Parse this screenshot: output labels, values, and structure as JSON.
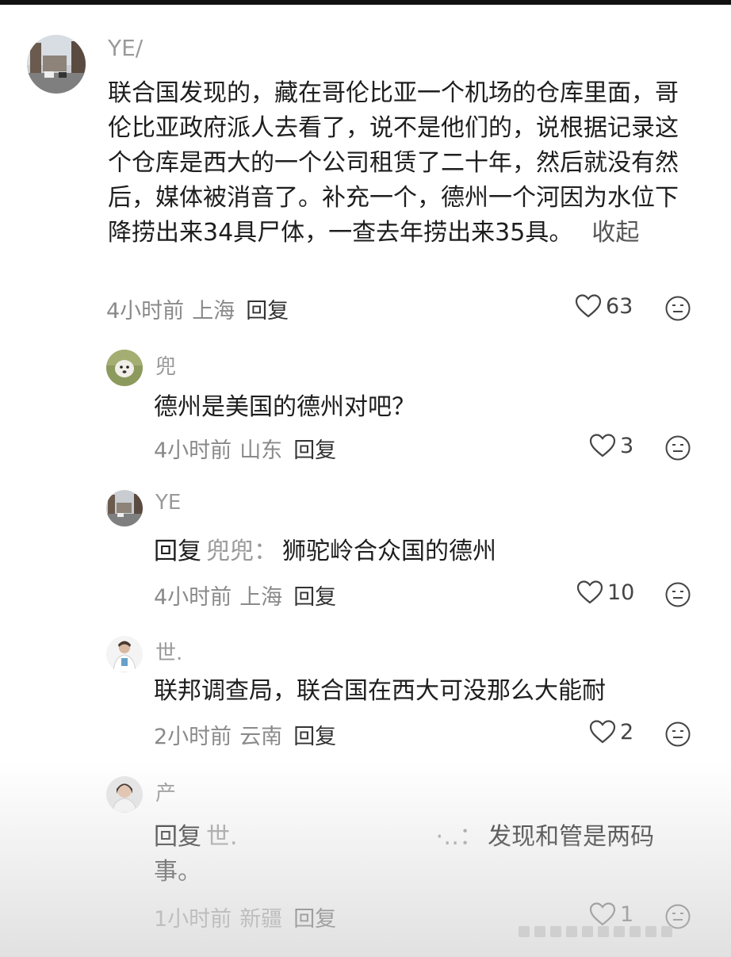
{
  "comments": [
    {
      "username": "YE/",
      "text": "联合国发现的，藏在哥伦比亚一个机场的仓库里面，哥伦比亚政府派人去看了，说不是他们的，说根据记录这个仓库是西大的一个公司租赁了二十年，然后就没有然后，媒体被消音了。补充一个，德州一个河因为水位下降捞出来34具尸体，一查去年捞出来35具。",
      "collapse_label": "收起",
      "time": "4小时前",
      "location": "上海",
      "reply_label": "回复",
      "likes": "63"
    },
    {
      "username": "兜",
      "text": "德州是美国的德州对吧？",
      "time": "4小时前",
      "location": "山东",
      "reply_label": "回复",
      "likes": "3"
    },
    {
      "username": "YE",
      "reply_prefix": "回复",
      "reply_to": "兜兜：",
      "text": "狮驼岭合众国的德州",
      "time": "4小时前",
      "location": "上海",
      "reply_label": "回复",
      "likes": "10"
    },
    {
      "username": "世.",
      "text": "联邦调查局，联合国在西大可没那么大能耐",
      "time": "2小时前",
      "location": "云南",
      "reply_label": "回复",
      "likes": "2"
    },
    {
      "username": "产",
      "reply_prefix": "回复",
      "reply_to": "世.",
      "reply_to_suffix": "·‥：",
      "text": "发现和管是两码事。",
      "time": "1小时前",
      "location": "新疆",
      "reply_label": "回复",
      "likes": "1"
    }
  ],
  "icons": {
    "like": "heart-outline-icon",
    "react": "smiley-face-icon"
  },
  "colors": {
    "text": "#1e1e1e",
    "muted": "#9a9a9a",
    "meta": "#8a8a8a"
  }
}
